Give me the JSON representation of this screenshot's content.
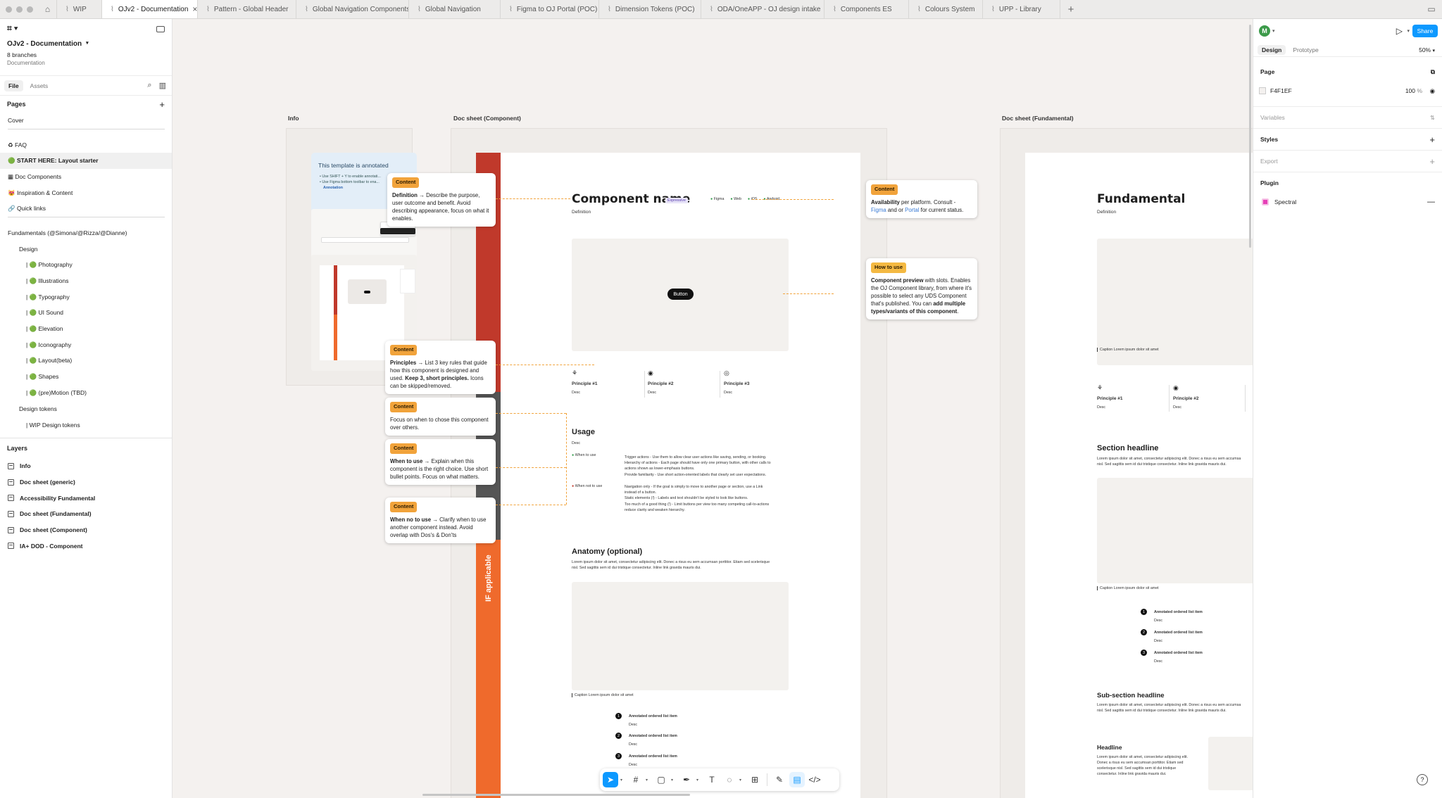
{
  "tabs": [
    {
      "label": "WIP",
      "active": false
    },
    {
      "label": "OJv2 - Documentation",
      "active": true
    },
    {
      "label": "Pattern - Global Header",
      "active": false
    },
    {
      "label": "Global Navigation Components",
      "active": false
    },
    {
      "label": "Global Navigation",
      "active": false
    },
    {
      "label": "Figma to OJ Portal (POC)",
      "active": false
    },
    {
      "label": "Dimension Tokens (POC)",
      "active": false
    },
    {
      "label": "ODA/OneAPP - OJ design intake",
      "active": false
    },
    {
      "label": "Components ES",
      "active": false
    },
    {
      "label": "Colours System",
      "active": false
    },
    {
      "label": "UPP - Library",
      "active": false
    }
  ],
  "left": {
    "file_title": "OJv2 - Documentation",
    "branches": "8 branches",
    "section": "Documentation",
    "tab_file": "File",
    "tab_assets": "Assets",
    "pages_heading": "Pages",
    "layers_heading": "Layers",
    "pages": [
      {
        "label": "Cover",
        "cls": ""
      },
      {
        "label": "",
        "cls": "spacer"
      },
      {
        "label": "♻ FAQ",
        "cls": ""
      },
      {
        "label": "🟢 START HERE: Layout starter",
        "cls": "sel"
      },
      {
        "label": "▦ Doc Components",
        "cls": ""
      },
      {
        "label": "😻 Inspiration & Content",
        "cls": ""
      },
      {
        "label": "🔗 Quick links",
        "cls": ""
      },
      {
        "label": "",
        "cls": "spacer"
      },
      {
        "label": "Fundamentals (@Simona/@Rizza/@Dianne)",
        "cls": ""
      },
      {
        "label": "Design",
        "cls": "ind1"
      },
      {
        "label": "| 🟢 Photography",
        "cls": "ind2"
      },
      {
        "label": "| 🟢 Illustrations",
        "cls": "ind2"
      },
      {
        "label": "| 🟢 Typography",
        "cls": "ind2"
      },
      {
        "label": "| 🟢 UI Sound",
        "cls": "ind2"
      },
      {
        "label": "| 🟢 Elevation",
        "cls": "ind2"
      },
      {
        "label": "| 🟢 Iconography",
        "cls": "ind2"
      },
      {
        "label": "| 🟢 Layout(beta)",
        "cls": "ind2"
      },
      {
        "label": "| 🟢 Shapes",
        "cls": "ind2"
      },
      {
        "label": "| 🟢 (pre)Motion (TBD)",
        "cls": "ind2"
      },
      {
        "label": "Design tokens",
        "cls": "ind1"
      },
      {
        "label": "| WIP Design tokens",
        "cls": "ind2"
      }
    ],
    "layers": [
      "Info",
      "Doc sheet (generic)",
      "Accessibility Fundamental",
      "Doc sheet (Fundamental)",
      "Doc sheet (Component)",
      "IA+ DOD - Component"
    ]
  },
  "right": {
    "avatar": "M",
    "share": "Share",
    "tab_design": "Design",
    "tab_prototype": "Prototype",
    "zoom": "50%",
    "page_heading": "Page",
    "page_fill": "F4F1EF",
    "page_opacity": "100",
    "page_opacity_unit": "%",
    "variables": "Variables",
    "styles": "Styles",
    "export": "Export",
    "plugin": "Plugin",
    "plugin_name": "Spectral"
  },
  "canvas": {
    "frame_info": "Info",
    "frame_component": "Doc sheet (Component)",
    "frame_fundamental": "Doc sheet (Fundamental)",
    "template_title": "This template is annotated",
    "template_line1": "• Use SHIFT + Y to enable annotati...",
    "template_line2": "• Use Figma bottom toolbar to ena...",
    "template_line3": "Annotation",
    "comp_name": "Component name",
    "comp_badge": "Expressive",
    "comp_platforms": [
      "Figma",
      "Web",
      "iOS",
      "Android"
    ],
    "comp_definition": "Definition",
    "comp_button": "Button",
    "principles": [
      "Principle #1",
      "Principle #2",
      "Principle #3"
    ],
    "desc": "Desc",
    "usage": "Usage",
    "when_to_use": "When to use",
    "when_not": "When not to use",
    "use_list": [
      "Trigger actions - Use them to allow clear user actions like saving, sending, or booking.",
      "Hierarchy of actions - Each page should have only one primary button, with other calls to",
      "actions shown as lower-emphasis buttons.",
      "Provide familiarity - Use short action-oriented labels that clearly set user expectations."
    ],
    "notuse_list": [
      "Navigation only - If the goal is simply to move to another page or section, use a Link",
      "instead of a button.",
      "Static elements (!) - Labels and text shouldn't be styled to look like buttons.",
      "Too much of a good thing (!) - Limit buttons per view too many competing call-to-actions",
      "reduce clarity and weaken hierarchy."
    ],
    "anatomy": "Anatomy (optional)",
    "anatomy_body1": "Lorem ipsum dolor sit amet, consectetur adipiscing elit. Donec a risus eu sem accumsan porttitor. Etiam sed scelerisque",
    "anatomy_body2": "nisl. Sed sagittis sem id dui tristique consectetur. Inline link gravida mauris dui.",
    "caption": "Caption Lorem ipsum dolor sit amet",
    "ordered_item": "Annotated ordered list item",
    "if_applicable": "IF applicable",
    "fund_title": "Fundamental",
    "section_headline": "Section headline",
    "sub_section": "Sub-section headline",
    "headline": "Headline",
    "body1": "Lorem ipsum dolor sit amet, consectetur adipiscing elit. Donec a risus eu sem accumsa",
    "body2": "nisl. Sed sagittis sem id dui tristique consectetur. Inline link gravida mauris dui.",
    "hl_body1": "Lorem ipsum dolor sit amet, consectetur adipiscing elit.",
    "hl_body2": "Donec a risus eu sem accumsan porttitor. Etiam sed",
    "hl_body3": "scelerisque nisl. Sed sagittis sem id dui tristique",
    "hl_body4": "consectetur. Inline link gravida mauris dui."
  },
  "notes": {
    "n1_tag": "Content",
    "n1_b": "Definition",
    "n1_t": " → Describe the purpose, user outcome and benefit. Avoid describing appearance, focus on what it enables.",
    "n2_tag": "Content",
    "n2_b": "Principles",
    "n2_t": " → List 3 key rules that guide how this component is designed and used. ",
    "n2_b2": "Keep 3, short principles.",
    "n2_t2": " Icons can be skipped/removed.",
    "n3_tag": "Content",
    "n3_t": "Focus on when to chose this component over others.",
    "n4_tag": "Content",
    "n4_b": "When to use",
    "n4_t": " → Explain when this component is the right choice. Use short bullet points. Focus on what matters.",
    "n5_tag": "Content",
    "n5_b": "When no to use",
    "n5_t": " → Clarify when to use another component instead. Avoid overlap with Dos's & Don'ts",
    "n6_tag": "Content",
    "n6_b": "Availability",
    "n6_t1": " per platform. Consult - ",
    "n6_l1": "Figma",
    "n6_t2": " and or ",
    "n6_l2": "Portal",
    "n6_t3": " for current status.",
    "n7_tag": "How to use",
    "n7_b": "Component preview",
    "n7_t": " with slots. Enables the OJ Component library, from where it's possible to select any UDS Component that's published. You can ",
    "n7_b2": "add multiple types/variants of this component",
    "n7_t2": "."
  }
}
